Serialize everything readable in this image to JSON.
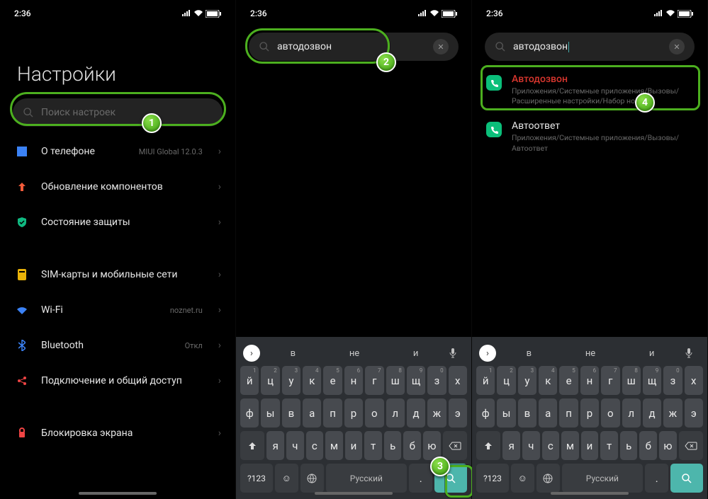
{
  "status": {
    "time": "2:36"
  },
  "screen1": {
    "title": "Настройки",
    "search_placeholder": "Поиск настроек",
    "items": [
      {
        "label": "О телефоне",
        "value": "MIUI Global 12.0.3",
        "color": "#3b82f6",
        "glyph": "▬"
      },
      {
        "label": "Обновление компонентов",
        "value": "",
        "color": "#f25b3a",
        "glyph": "⬆"
      },
      {
        "label": "Состояние защиты",
        "value": "",
        "color": "#10b981",
        "glyph": "✦"
      },
      {
        "gap": true
      },
      {
        "label": "SIM-карты и мобильные сети",
        "value": "",
        "color": "#eab308",
        "glyph": "▮"
      },
      {
        "label": "Wi-Fi",
        "value": "noznet.ru",
        "color": "#3b82f6",
        "glyph": "�態"
      },
      {
        "label": "Bluetooth",
        "value": "Откл",
        "color": "#3b82f6",
        "glyph": "⟐"
      },
      {
        "label": "Подключение и общий доступ",
        "value": "",
        "color": "#ef4444",
        "glyph": "⟨⟩"
      },
      {
        "gap": true
      },
      {
        "label": "Блокировка экрана",
        "value": "",
        "color": "#ef4444",
        "glyph": "⬢"
      }
    ]
  },
  "screen2": {
    "search_value": "автодозвон"
  },
  "screen3": {
    "search_value": "автодозвон",
    "results": [
      {
        "title": "Автодозвон",
        "red": true,
        "path": "Приложения/Системные приложения/Вызовы/Расширенные настройки/Набор номера"
      },
      {
        "title": "Автоответ",
        "red": false,
        "path": "Приложения/Системные приложения/Вызовы/Автоответ"
      }
    ]
  },
  "keyboard": {
    "suggestions": [
      "в",
      "не",
      "и"
    ],
    "row1": [
      "й",
      "ц",
      "у",
      "к",
      "е",
      "н",
      "г",
      "ш",
      "щ",
      "з",
      "х"
    ],
    "row1sup": [
      "1",
      "2",
      "3",
      "4",
      "5",
      "6",
      "7",
      "8",
      "9",
      "0",
      ""
    ],
    "row2": [
      "ф",
      "ы",
      "в",
      "а",
      "п",
      "р",
      "о",
      "л",
      "д",
      "ж",
      "э"
    ],
    "row3": [
      "я",
      "ч",
      "с",
      "м",
      "и",
      "т",
      "ь",
      "б",
      "ю"
    ],
    "space_label": "Русский",
    "num_label": "?123"
  },
  "badges": {
    "b1": "1",
    "b2": "2",
    "b3": "3",
    "b4": "4"
  }
}
